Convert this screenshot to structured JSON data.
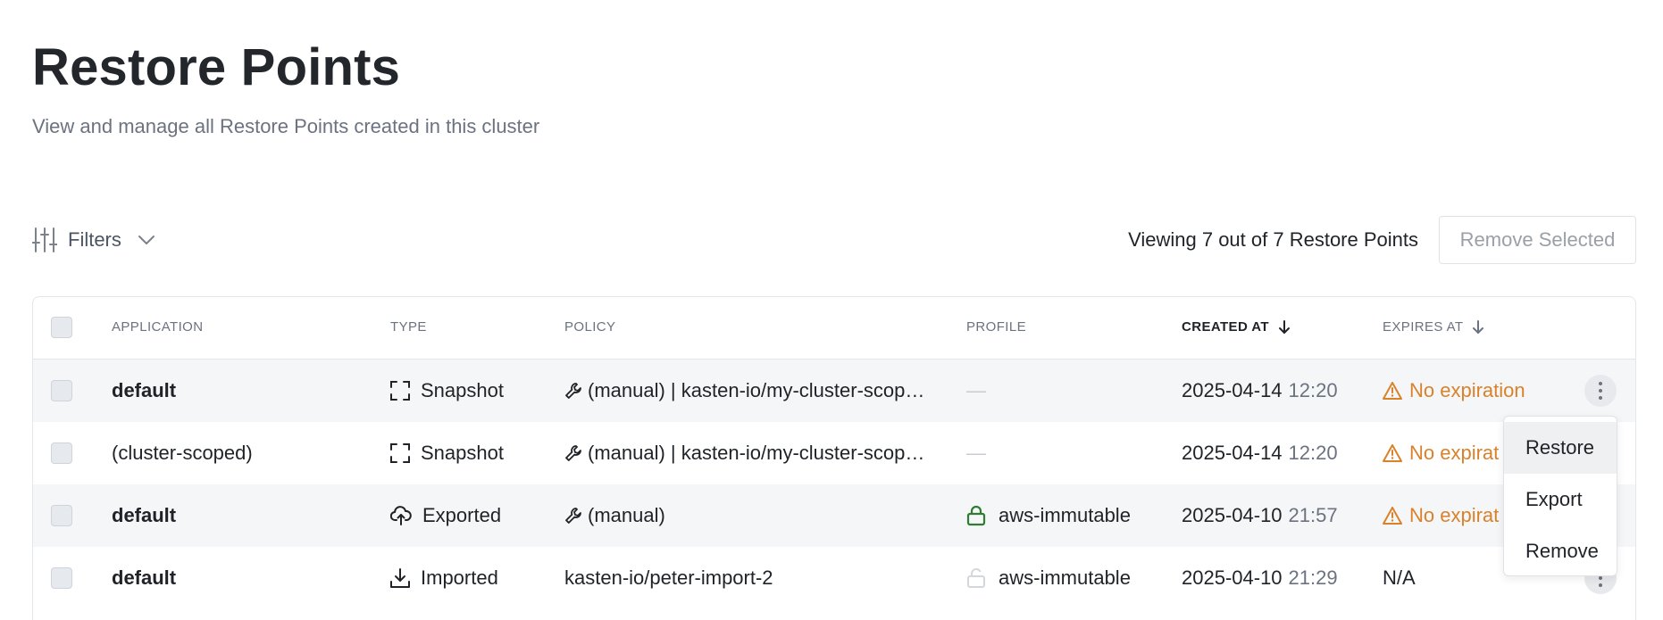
{
  "header": {
    "title": "Restore Points",
    "subtitle": "View and manage all Restore Points created in this cluster"
  },
  "toolbar": {
    "filters_label": "Filters",
    "viewing_count": "Viewing 7 out of 7 Restore Points",
    "remove_selected_label": "Remove Selected"
  },
  "table": {
    "columns": {
      "application": "APPLICATION",
      "type": "TYPE",
      "policy": "POLICY",
      "profile": "PROFILE",
      "created_at": "CREATED AT",
      "expires_at": "EXPIRES AT"
    },
    "rows": [
      {
        "application": "default",
        "type": "Snapshot",
        "type_icon": "snapshot-icon",
        "policy": "(manual) | kasten-io/my-cluster-scop…",
        "profile": "—",
        "created_date": "2025-04-14",
        "created_time": "12:20",
        "expires": "No expiration"
      },
      {
        "application": "(cluster-scoped)",
        "type": "Snapshot",
        "type_icon": "snapshot-icon",
        "policy": "(manual) | kasten-io/my-cluster-scop…",
        "profile": "—",
        "created_date": "2025-04-14",
        "created_time": "12:20",
        "expires": "No expirat"
      },
      {
        "application": "default",
        "type": "Exported",
        "type_icon": "cloud-upload-icon",
        "policy": "(manual)",
        "profile": "aws-immutable",
        "profile_icon": "lock-closed-icon",
        "created_date": "2025-04-10",
        "created_time": "21:57",
        "expires": "No expirat"
      },
      {
        "application": "default",
        "type": "Imported",
        "type_icon": "download-icon",
        "policy": "kasten-io/peter-import-2",
        "profile": "aws-immutable",
        "profile_icon": "lock-open-icon",
        "created_date": "2025-04-10",
        "created_time": "21:29",
        "expires": "N/A"
      }
    ]
  },
  "context_menu": {
    "items": [
      "Restore",
      "Export",
      "Remove"
    ]
  },
  "colors": {
    "warning": "#d9822b",
    "lock_green": "#2e7d32",
    "row_shade": "#f5f6f7"
  }
}
